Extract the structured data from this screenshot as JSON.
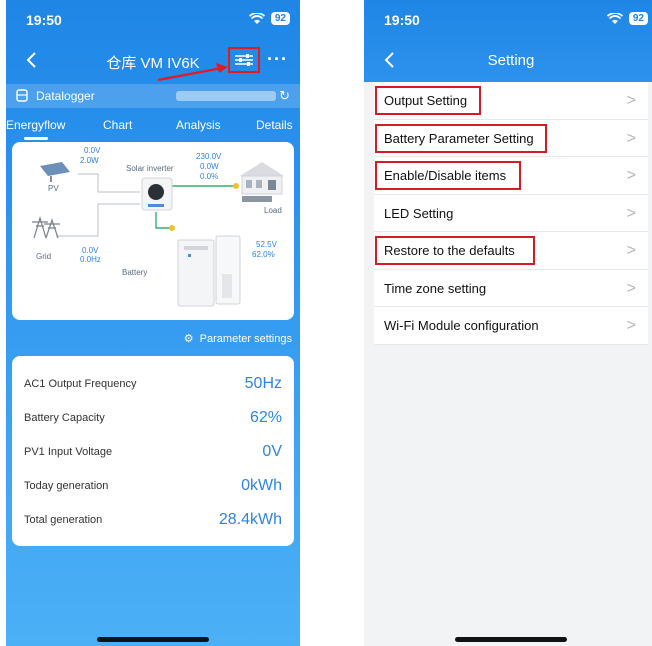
{
  "left": {
    "status": {
      "time": "19:50",
      "battery": "92"
    },
    "nav": {
      "title": "仓库 VM IV6K",
      "more": "···"
    },
    "datalogger": {
      "label": "Datalogger"
    },
    "tabs": [
      "Energyflow",
      "Chart",
      "Analysis",
      "Details"
    ],
    "flow": {
      "pv_label": "PV",
      "pv_voltage": "0.0V",
      "pv_power": "2.0W",
      "inverter_label": "Solar inverter",
      "load_voltage": "230.0V",
      "load_power": "0.0W",
      "load_percent": "0.0%",
      "load_label": "Load",
      "grid_label": "Grid",
      "grid_voltage": "0.0V",
      "grid_freq": "0.0Hz",
      "battery_label": "Battery",
      "battery_voltage": "52.5V",
      "battery_percent": "62.0%"
    },
    "param_settings": "Parameter settings",
    "stats": [
      {
        "label": "AC1 Output Frequency",
        "value": "50Hz"
      },
      {
        "label": "Battery Capacity",
        "value": "62%"
      },
      {
        "label": "PV1 Input Voltage",
        "value": "0V"
      },
      {
        "label": "Today generation",
        "value": "0kWh"
      },
      {
        "label": "Total generation",
        "value": "28.4kWh"
      }
    ]
  },
  "right": {
    "status": {
      "time": "19:50",
      "battery": "92"
    },
    "title": "Setting",
    "menu": [
      "Output Setting",
      "Battery Parameter Setting",
      "Enable/Disable items",
      "LED Setting",
      "Restore to the defaults",
      "Time zone setting",
      "Wi-Fi Module configuration"
    ],
    "chevron": ">"
  },
  "colors": {
    "accent_blue": "#1f86e6",
    "value_blue": "#2f84e0",
    "highlight_red": "#d11c24"
  }
}
